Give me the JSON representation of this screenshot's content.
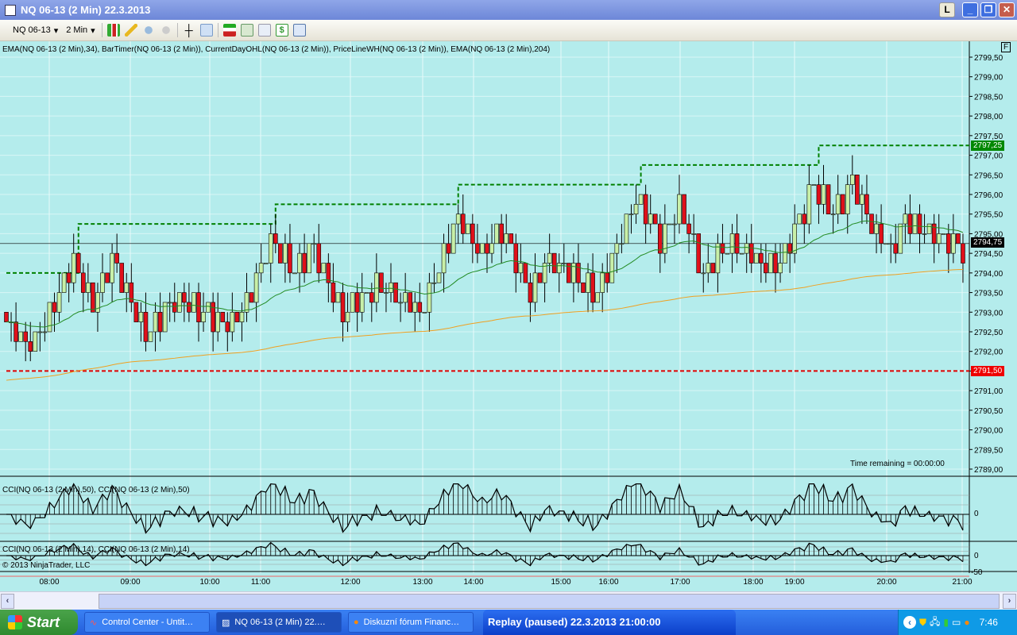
{
  "window": {
    "title": "NQ 06-13 (2 Min)  22.3.2013",
    "btn_l": "L",
    "btn_min": "_",
    "btn_max": "❐",
    "btn_close": "✕"
  },
  "toolbar": {
    "instrument": "NQ 06-13",
    "interval": "2 Min",
    "dropdown": "▾"
  },
  "chart": {
    "indicators_label": "EMA(NQ 06-13 (2 Min),34), BarTimer(NQ 06-13 (2 Min)), CurrentDayOHL(NQ 06-13 (2 Min)), PriceLineWH(NQ 06-13 (2 Min)), EMA(NQ 06-13 (2 Min),204)",
    "f_button": "F",
    "time_remaining": "Time remaining = 00:00:00",
    "cci1_label": "CCI(NQ 06-13 (2 Min),50), CCI(NQ 06-13 (2 Min),50)",
    "cci2_label": "CCI(NQ 06-13 (2 Min),14), CCI(NQ 06-13 (2 Min),14)",
    "copyright": "© 2013 NinjaTrader, LLC",
    "cci1_zero": "0",
    "cci2_zero": "0",
    "cci2_minus": "-50",
    "last_price": "2794,75",
    "day_high": "2797,25",
    "day_low": "2791,50"
  },
  "chart_data": {
    "type": "candlestick",
    "price_ticks": [
      "2799,50",
      "2799,00",
      "2798,50",
      "2798,00",
      "2797,50",
      "2797,00",
      "2796,50",
      "2796,00",
      "2795,50",
      "2795,00",
      "2794,50",
      "2794,00",
      "2793,50",
      "2793,00",
      "2792,50",
      "2792,00",
      "2791,50",
      "2791,00",
      "2790,50",
      "2790,00",
      "2789,50",
      "2789,00"
    ],
    "ylim": [
      2789.0,
      2799.5
    ],
    "time_ticks": [
      "08:00",
      "09:00",
      "10:00",
      "11:00",
      "12:00",
      "13:00",
      "14:00",
      "15:00",
      "16:00",
      "17:00",
      "18:00",
      "19:00",
      "20:00",
      "21:00"
    ],
    "price_path": [
      [
        0,
        2792.66
      ],
      [
        5,
        2792.15
      ],
      [
        9,
        2792.86
      ],
      [
        14,
        2794.28
      ],
      [
        18,
        2793.27
      ],
      [
        22,
        2794.28
      ],
      [
        29,
        2792.45
      ],
      [
        35,
        2793.37
      ],
      [
        46,
        2792.66
      ],
      [
        51,
        2793.47
      ],
      [
        55,
        2794.88
      ],
      [
        60,
        2794.07
      ],
      [
        64,
        2794.68
      ],
      [
        70,
        2792.96
      ],
      [
        77,
        2793.67
      ],
      [
        86,
        2793.06
      ],
      [
        90,
        2794.07
      ],
      [
        94,
        2795.39
      ],
      [
        99,
        2794.48
      ],
      [
        103,
        2795.09
      ],
      [
        109,
        2793.47
      ],
      [
        113,
        2794.38
      ],
      [
        123,
        2793.47
      ],
      [
        127,
        2794.68
      ],
      [
        131,
        2795.9
      ],
      [
        136,
        2794.88
      ],
      [
        140,
        2795.69
      ],
      [
        145,
        2793.97
      ],
      [
        150,
        2794.78
      ],
      [
        160,
        2794.07
      ],
      [
        164,
        2795.09
      ],
      [
        168,
        2796.2
      ],
      [
        172,
        2795.49
      ],
      [
        176,
        2796.3
      ],
      [
        181,
        2794.98
      ],
      [
        184,
        2794.58
      ],
      [
        187,
        2795.39
      ],
      [
        194,
        2794.88
      ],
      [
        199,
        2794.58
      ]
    ],
    "day_high_steps": [
      [
        0,
        2794.0
      ],
      [
        15,
        2795.25
      ],
      [
        56,
        2795.75
      ],
      [
        94,
        2796.25
      ],
      [
        132,
        2796.75
      ],
      [
        169,
        2797.25
      ]
    ],
    "day_low": 2791.5,
    "last": 2794.75,
    "colors": {
      "up": "#c8f0a8",
      "down": "#e0101a",
      "ema34": "#228b22",
      "ema204": "#f0a020",
      "high": "#008000",
      "low": "#e00000"
    }
  },
  "taskbar": {
    "start": "Start",
    "tasks": [
      "Control Center - Untit…",
      "NQ 06-13 (2 Min)  22.…",
      "Diskuzní fórum Financ…"
    ],
    "replay": "Replay (paused) 22.3.2013 21:00:00",
    "clock": "7:46"
  }
}
